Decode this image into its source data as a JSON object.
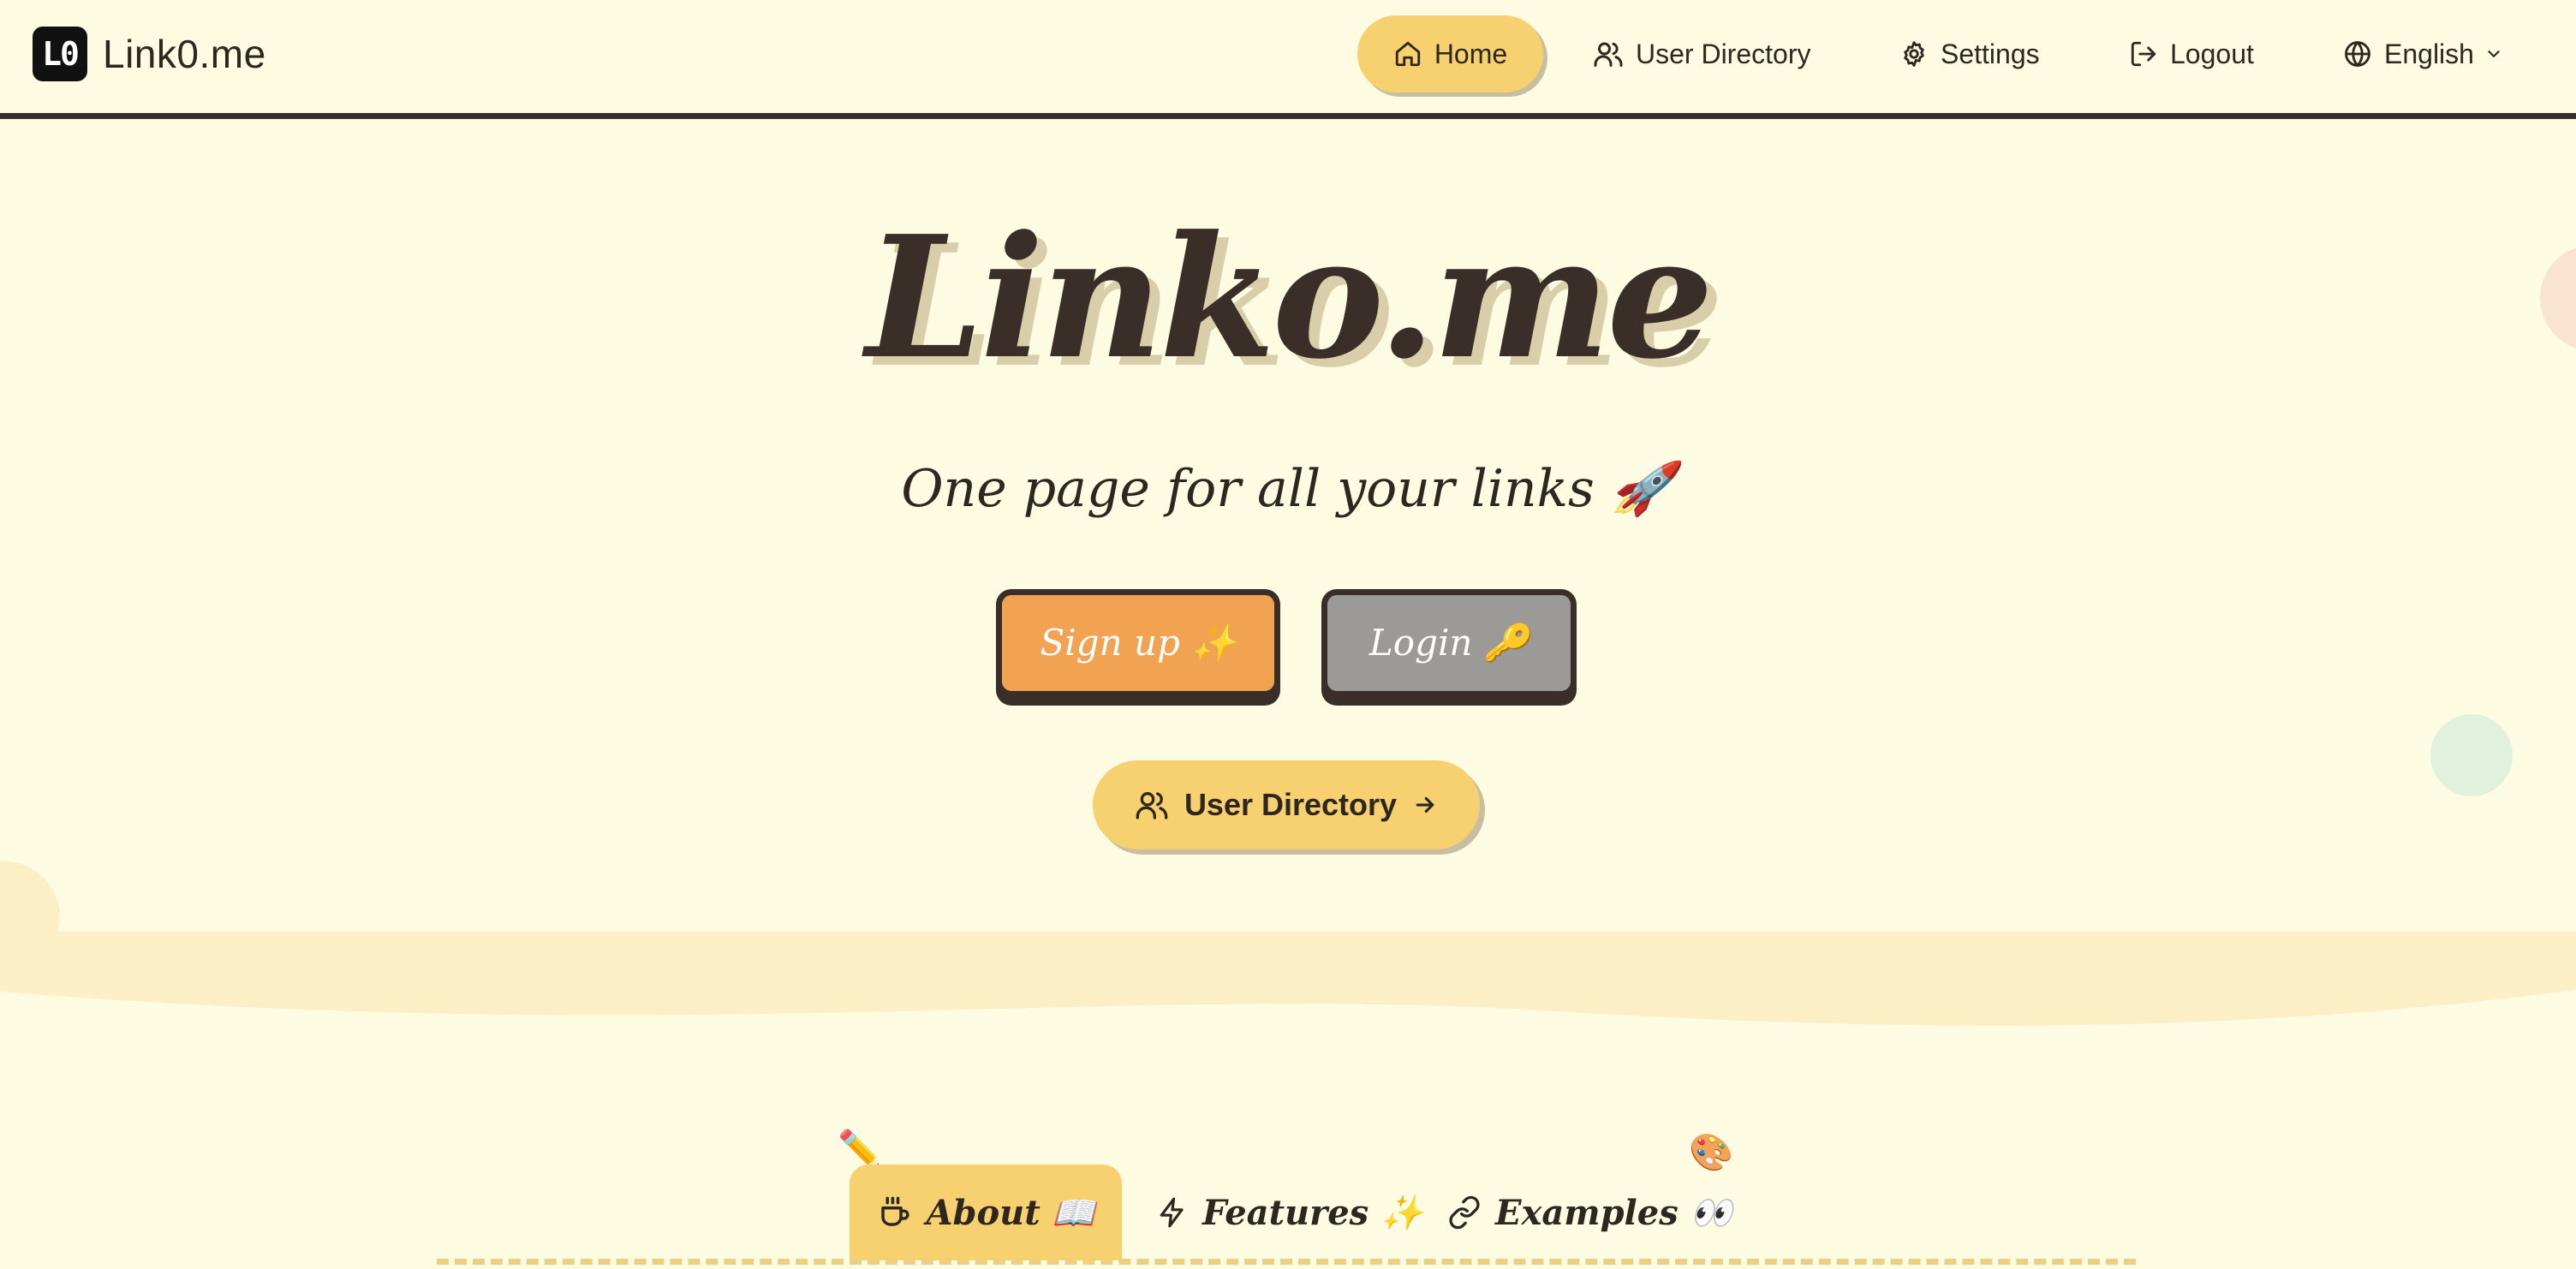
{
  "header": {
    "logo_text": "L0",
    "brand_name": "Link0.me",
    "nav": {
      "home": "Home",
      "user_directory": "User Directory",
      "settings": "Settings",
      "logout": "Logout",
      "language": "English"
    }
  },
  "hero": {
    "title": "Linko.me",
    "subtitle": "One page for all your links 🚀",
    "signup_label": "Sign up ✨",
    "login_label": "Login 🔑",
    "directory_label": "User Directory"
  },
  "tabs": {
    "about": "About 📖",
    "features": "Features ✨",
    "examples": "Examples 👀"
  },
  "decorations": {
    "pencil": "✏️",
    "palette": "🎨"
  },
  "colors": {
    "background": "#fefbe3",
    "accent_yellow": "#f7d06f",
    "signup_orange": "#f1a352",
    "login_gray": "#9c9a97",
    "dark_brown": "#3a2f28"
  },
  "icons": {
    "home": "home-icon",
    "users": "users-icon",
    "settings": "gear-icon",
    "logout": "logout-icon",
    "language": "globe-icon",
    "dropdown": "chevron-down-icon",
    "arrow": "arrow-right-icon",
    "about": "coffee-cup-icon",
    "features": "lightning-icon",
    "examples": "link-icon"
  }
}
